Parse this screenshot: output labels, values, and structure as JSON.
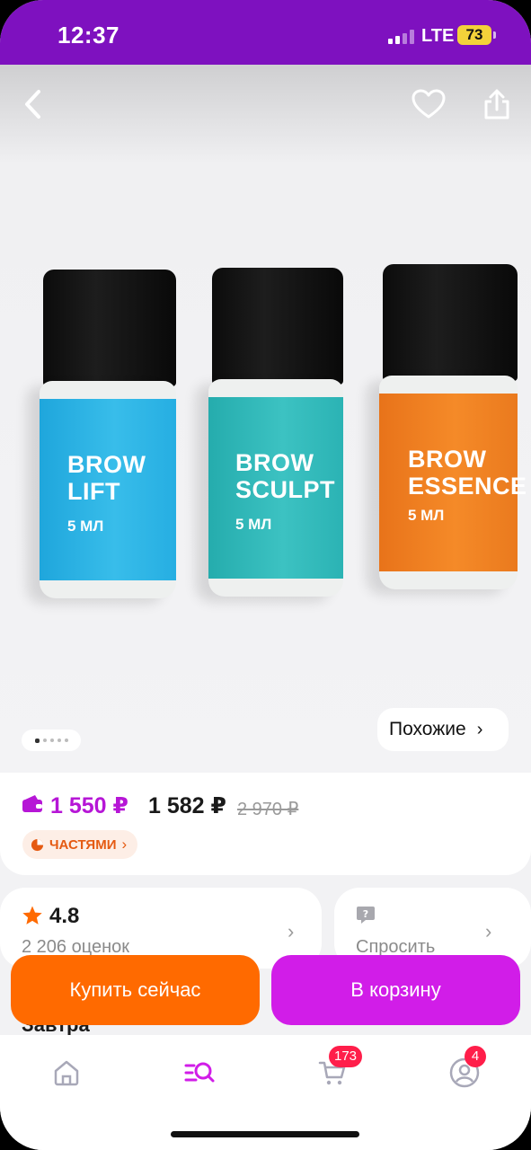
{
  "status_bar": {
    "time": "12:37",
    "network": "LTE",
    "battery": "73"
  },
  "hero": {
    "bottles": [
      {
        "title_line1": "BROW",
        "title_line2": "LIFT",
        "volume": "5 МЛ",
        "color": "#29b3e5"
      },
      {
        "title_line1": "BROW",
        "title_line2": "SCULPT",
        "volume": "5 МЛ",
        "color": "#2fb9b9"
      },
      {
        "title_line1": "BROW",
        "title_line2": "ESSENCE",
        "volume": "5 МЛ",
        "color": "#f0801e"
      }
    ],
    "similar_label": "Похожие"
  },
  "price": {
    "wallet_price": "1 550 ₽",
    "price": "1 582 ₽",
    "old_price": "2 970 ₽",
    "installments_label": "ЧАСТЯМИ"
  },
  "rating": {
    "value": "4.8",
    "count_label": "2 206 оценок"
  },
  "ask": {
    "label": "Спросить"
  },
  "delivery": {
    "label": "Завтра"
  },
  "actions": {
    "buy_now": "Купить сейчас",
    "add_to_cart": "В корзину"
  },
  "tabbar": {
    "cart_badge": "173",
    "profile_badge": "4"
  },
  "colors": {
    "brand_purple": "#7e11bf",
    "accent_magenta": "#d11de8",
    "accent_orange": "#ff6a00",
    "badge_red": "#ff1e4a"
  }
}
